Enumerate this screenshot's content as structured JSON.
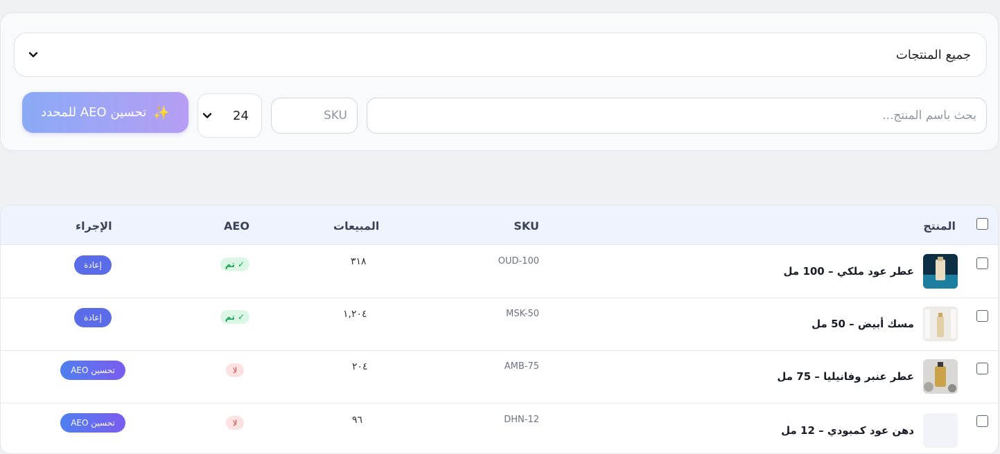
{
  "filters": {
    "category": "جميع المنتجات",
    "search_placeholder": "بحث باسم المنتج...",
    "sku_placeholder": "SKU",
    "per_page": "24",
    "bulk_button_label": "تحسين AEO للمحدد",
    "bulk_button_icon": "sparkles-icon"
  },
  "table": {
    "headers": {
      "product": "المنتج",
      "sku": "SKU",
      "sales": "المبيعات",
      "aeo": "AEO",
      "action": "الإجراء"
    },
    "rows": [
      {
        "name": "عطر عود ملكي – 100 مل",
        "sku": "OUD-100",
        "sales": "٣١٨",
        "aeo": "✓ تم",
        "action": "إعادة"
      },
      {
        "name": "مسك أبيض – 50 مل",
        "sku": "MSK-50",
        "sales": "١,٢٠٤",
        "aeo": "✓ تم",
        "action": "إعادة"
      },
      {
        "name": "عطر عنبر وفانيليا – 75 مل",
        "sku": "AMB-75",
        "sales": "٢٠٤",
        "aeo": "لا",
        "action": "تحسين AEO"
      },
      {
        "name": "دهن عود كمبودي – 12 مل",
        "sku": "DHN-12",
        "sales": "٩٦",
        "aeo": "لا",
        "action": "تحسين AEO"
      }
    ]
  },
  "colors": {
    "accent": "#5b6ce8",
    "done_badge": "#12a150",
    "no_badge": "#dc3030"
  }
}
